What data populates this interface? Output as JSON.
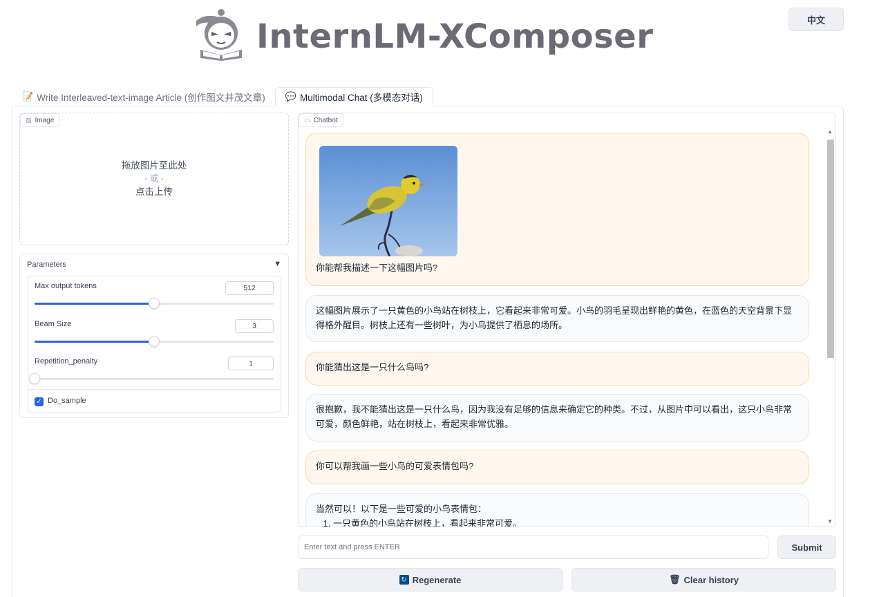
{
  "header": {
    "title": "InternLM-XComposer",
    "lang_button": "中文"
  },
  "tabs": [
    {
      "label": "Write Interleaved-text-image Article (创作图文并茂文章)",
      "icon": "memo-icon",
      "active": false
    },
    {
      "label": "Multimodal Chat (多模态对话)",
      "icon": "speech-bubble-icon",
      "active": true
    }
  ],
  "image_upload": {
    "label": "Image",
    "drop_text": "拖放图片至此处",
    "or_text": "- 或 -",
    "click_text": "点击上传"
  },
  "parameters": {
    "title": "Parameters",
    "sliders": [
      {
        "label": "Max output tokens",
        "value": "512",
        "fraction": 0.5
      },
      {
        "label": "Beam Size",
        "value": "3",
        "fraction": 0.5
      },
      {
        "label": "Repetition_penalty",
        "value": "1",
        "fraction": 0.0
      }
    ],
    "checkbox": {
      "label": "Do_sample",
      "checked": true
    }
  },
  "chatbot": {
    "label": "Chatbot",
    "messages": [
      {
        "role": "user",
        "has_image": true,
        "text": "你能帮我描述一下这幅图片吗?"
      },
      {
        "role": "bot",
        "text": "这幅图片展示了一只黄色的小鸟站在树枝上，它看起来非常可爱。小鸟的羽毛呈现出鲜艳的黄色，在蓝色的天空背景下显得格外醒目。树枝上还有一些树叶，为小鸟提供了栖息的场所。"
      },
      {
        "role": "user",
        "text": "你能猜出这是一只什么鸟吗?"
      },
      {
        "role": "bot",
        "text": "很抱歉，我不能猜出这是一只什么鸟，因为我没有足够的信息来确定它的种类。不过，从图片中可以看出，这只小鸟非常可爱，颜色鲜艳，站在树枝上，看起来非常优雅。"
      },
      {
        "role": "user",
        "text": "你可以帮我画一些小鸟的可爱表情包吗?"
      },
      {
        "role": "bot",
        "text": "当然可以！以下是一些可爱的小鸟表情包：",
        "list": [
          "一只黄色的小鸟站在树枝上，看起来非常可爱。"
        ]
      }
    ]
  },
  "input": {
    "placeholder": "Enter text and press ENTER",
    "submit_label": "Submit"
  },
  "actions": {
    "regenerate_label": "Regenerate",
    "clear_label": "Clear history"
  }
}
